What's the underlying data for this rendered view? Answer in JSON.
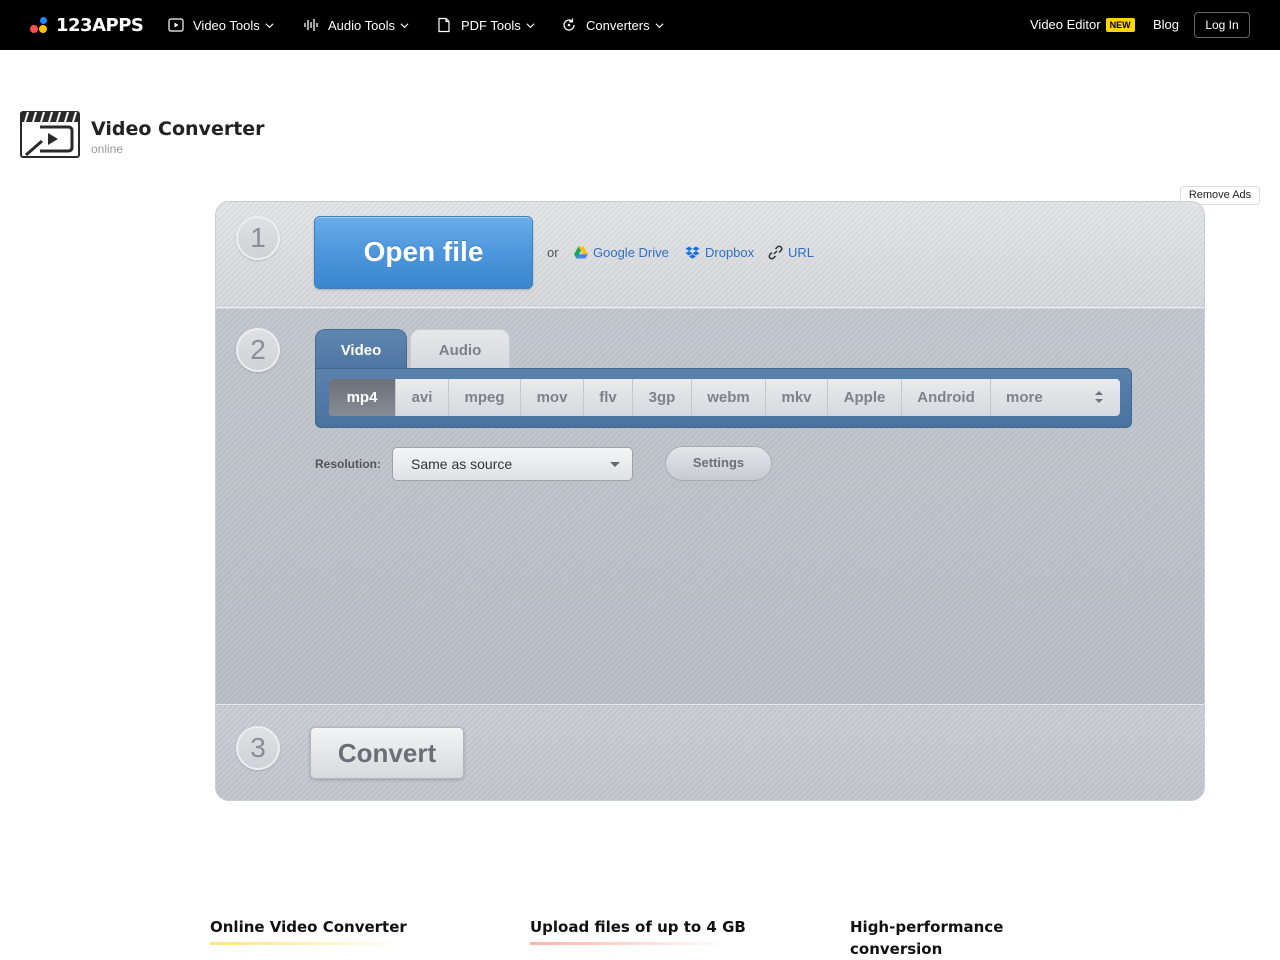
{
  "nav": {
    "logo": "123APPS",
    "menu": [
      {
        "label": "Video Tools"
      },
      {
        "label": "Audio Tools"
      },
      {
        "label": "PDF Tools"
      },
      {
        "label": "Converters"
      }
    ],
    "video_editor": "Video Editor",
    "badge_new": "NEW",
    "blog": "Blog",
    "login": "Log In"
  },
  "header": {
    "title": "Video Converter",
    "subtitle": "online"
  },
  "remove_ads": "Remove Ads",
  "step1": {
    "number": "1",
    "open_file": "Open file",
    "or": "or",
    "sources": {
      "gdrive": "Google Drive",
      "dropbox": "Dropbox",
      "url": "URL"
    }
  },
  "step2": {
    "number": "2",
    "tabs": {
      "video": "Video",
      "audio": "Audio"
    },
    "formats": [
      "mp4",
      "avi",
      "mpeg",
      "mov",
      "flv",
      "3gp",
      "webm",
      "mkv",
      "Apple",
      "Android"
    ],
    "more": "more",
    "selected_format": "mp4",
    "resolution_label": "Resolution:",
    "resolution_value": "Same as source",
    "settings": "Settings"
  },
  "step3": {
    "number": "3",
    "convert": "Convert"
  },
  "features": [
    {
      "title": "Online Video Converter"
    },
    {
      "title": "Upload files of up to 4 GB"
    },
    {
      "title": "High-performance conversion"
    }
  ],
  "colors": {
    "accent_blue": "#4d96dc",
    "tab_blue": "#4e76a2",
    "badge_yellow": "#ffd400"
  }
}
